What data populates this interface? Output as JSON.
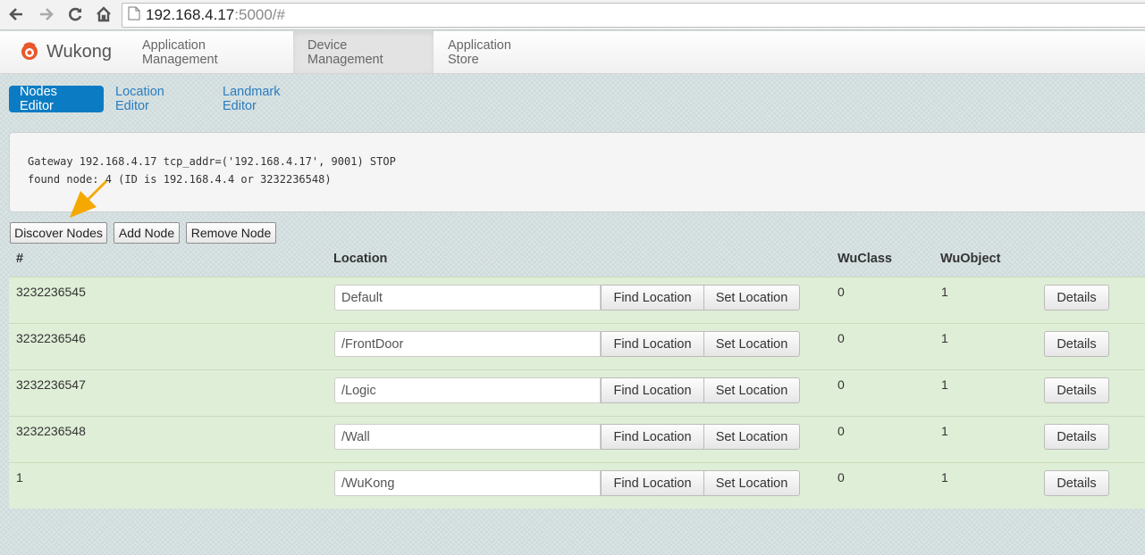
{
  "browser": {
    "url_host": "192.168.4.17",
    "url_rest": ":5000/#"
  },
  "navbar": {
    "brand": "Wukong",
    "items": [
      {
        "label": "Application Management"
      },
      {
        "label": "Device Management"
      },
      {
        "label": "Application Store"
      }
    ]
  },
  "tabs": {
    "nodes_editor": "Nodes Editor",
    "location_editor": "Location Editor",
    "landmark_editor": "Landmark Editor"
  },
  "console": {
    "line1": "Gateway 192.168.4.17 tcp_addr=('192.168.4.17', 9001) STOP",
    "line2": "found node: 4 (ID is 192.168.4.4 or 3232236548)"
  },
  "actions": {
    "discover": "Discover Nodes",
    "add": "Add Node",
    "remove": "Remove Node"
  },
  "table": {
    "headers": {
      "id": "#",
      "location": "Location",
      "wuclass": "WuClass",
      "wuobject": "WuObject"
    },
    "find_label": "Find Location",
    "set_label": "Set Location",
    "details_label": "Details",
    "rows": [
      {
        "id": "3232236545",
        "location": "Default",
        "wuclass": "0",
        "wuobject": "1"
      },
      {
        "id": "3232236546",
        "location": "/FrontDoor",
        "wuclass": "0",
        "wuobject": "1"
      },
      {
        "id": "3232236547",
        "location": "/Logic",
        "wuclass": "0",
        "wuobject": "1"
      },
      {
        "id": "3232236548",
        "location": "/Wall",
        "wuclass": "0",
        "wuobject": "1"
      },
      {
        "id": "1",
        "location": "/WuKong",
        "wuclass": "0",
        "wuobject": "1"
      }
    ]
  },
  "colors": {
    "primary": "#0b7cc4",
    "row_bg": "#dfeed6",
    "annotation_arrow": "#f5a800"
  }
}
